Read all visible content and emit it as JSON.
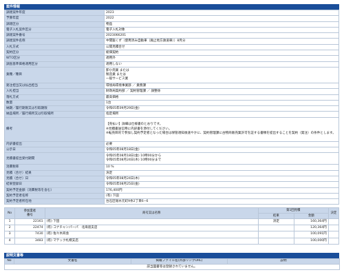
{
  "info_panel": {
    "title": "案件情報",
    "rows": [
      {
        "label": "調達案件年度",
        "value": "2023"
      },
      {
        "label": "予算年度",
        "value": "2022"
      },
      {
        "label": "調達区分",
        "value": "物品"
      },
      {
        "label": "電子入札案件区分",
        "value": "電子入札対象"
      },
      {
        "label": "調達案件番号",
        "value": "2023066201"
      },
      {
        "label": "調達案件名称",
        "value": "中間鈑くず（使用済み自動車（廃止地方鉄道車））8月分"
      },
      {
        "label": "入札方式",
        "value": "公開見積合せ"
      },
      {
        "label": "契約区分",
        "value": "総価契約"
      },
      {
        "label": "WTO区分",
        "value": "適用外"
      },
      {
        "label": "調査基準価格適用区分",
        "value": "適用しない"
      },
      {
        "label": "業種／種目",
        "value": "卸小売業 または\n製造業 または\n一般サービス業"
      },
      {
        "label": "発注担当又は払出担当",
        "value": "環境局環境事業部 ／ 業務課"
      },
      {
        "label": "入札担当",
        "value": "財政局契約部 ／ 契約管理課 ／ 調整係"
      },
      {
        "label": "落札方式",
        "value": "最高価格"
      },
      {
        "label": "数量",
        "value": "1台"
      },
      {
        "label": "納期／履行期限又は引取期限",
        "value": "令和05年09月29日(金)"
      },
      {
        "label": "納品場所／履行場所又は引取場所",
        "value": "指定場所"
      },
      {
        "label": "備考",
        "value": "【売払い】詳細は仕様書のとおりです。\n※見積書送信時に内訳書を添付してください。\n※転売目的で参加し契約予定者となった場合は保管適知後速やかに、契約管理課に古物商販売業許可を証する書類を提出することを契約（発注）の条件とします。"
      },
      {
        "label": "内訳書提出",
        "value": "必要"
      },
      {
        "label": "公示日",
        "value": "令和05年08月18日(金)"
      },
      {
        "label": "見積書提出受付期間",
        "value": "令和05年08月18日(金) 10時00分から\n令和05年08月24日(木) 10時00分まで"
      },
      {
        "label": "消費税率",
        "value": "10 %"
      },
      {
        "label": "見積（合せ）結果",
        "value": "決定"
      },
      {
        "label": "見積（合せ）日",
        "value": "令和05年08月24日(木)"
      },
      {
        "label": "結果登録日",
        "value": "令和05年08月25日(金)"
      },
      {
        "label": "契約予定金額（消費税等を含む）",
        "value": "176,400円"
      },
      {
        "label": "契約予定者名称",
        "value": "(有) 下田"
      },
      {
        "label": "契約予定者所在地",
        "value": "台石区堀水元町9条2丁目6−6"
      }
    ]
  },
  "bid_table": {
    "headers": {
      "no": "No",
      "reg_no": "参加業者\n番号",
      "name": "商号又は名称",
      "round": "第1回見積",
      "result": "結果",
      "amount": "金額",
      "decision": "決定"
    },
    "rows": [
      {
        "no": "1",
        "reg_no": "22161",
        "name": "(有) 下田",
        "result": "決定",
        "amount": "160,364円",
        "decision": ""
      },
      {
        "no": "2",
        "reg_no": "22474",
        "name": "(有) コナチャンパーパ　北海道支店",
        "result": "",
        "amount": "120,364円",
        "decision": ""
      },
      {
        "no": "3",
        "reg_no": "7430",
        "name": "(有) 佐々木商会",
        "result": "",
        "amount": "100,091円",
        "decision": ""
      },
      {
        "no": "4",
        "reg_no": "3483",
        "name": "(有) マテック札幌支店",
        "result": "",
        "amount": "100,000円",
        "decision": ""
      }
    ]
  },
  "doc_panel": {
    "title": "説明文書等",
    "headers": {
      "no": "No",
      "doc_name": "文書名",
      "file": "掲載ファイル名(外部リンクURL)",
      "desc": "説明"
    },
    "empty_message": "該当図書等は登録されていません。"
  }
}
